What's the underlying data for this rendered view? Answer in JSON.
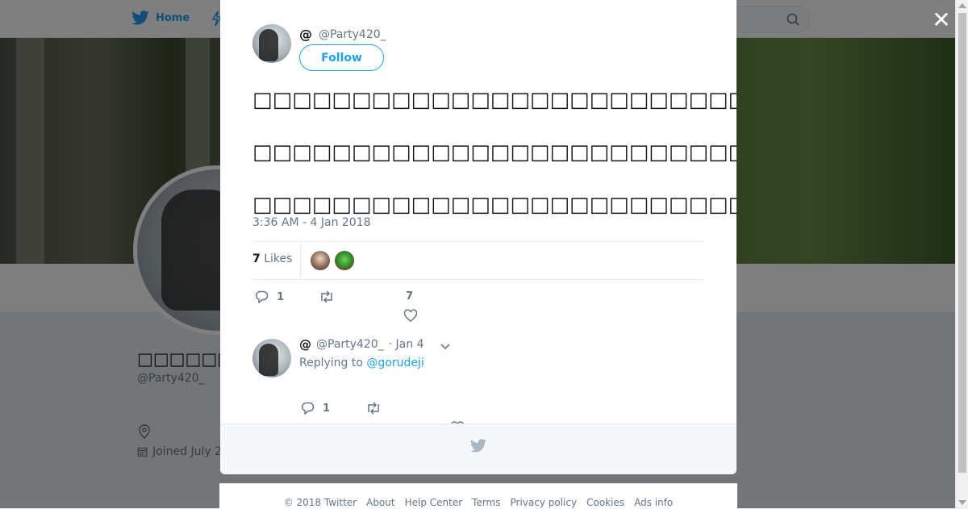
{
  "nav": {
    "home_label": "Home"
  },
  "profile": {
    "name": "□□□□□□□□",
    "handle": "@Party420_",
    "joined": "Joined July 2"
  },
  "tweet": {
    "author_at": "@",
    "author_handle": "@Party420_",
    "follow_label": "Follow",
    "lines": [
      "□□□□□□□□□□□□□□□□□□□□□□□□□□□□□□□□□□□□□□",
      "□□□□□□□□□□□□□□□□□□□□□□□□□□□□□□□□□□□□□□□□□□□😂",
      "□□□□□□□□□□□□□□□□□□□□□□□□□□"
    ],
    "timestamp": "3:36 AM - 4 Jan 2018",
    "likes_count": "7",
    "likes_label": "Likes",
    "reply_count": "1",
    "like_count": "7"
  },
  "reply": {
    "author_at": "@",
    "author_handle": "@Party420_",
    "date": "· Jan 4",
    "replying_prefix": "Replying to",
    "replying_to": "@gorudeji",
    "reply_count": "1"
  },
  "footer": {
    "links": [
      "© 2018 Twitter",
      "About",
      "Help Center",
      "Terms",
      "Privacy policy",
      "Cookies",
      "Ads info"
    ]
  },
  "colors": {
    "accent": "#1da1f2",
    "muted": "#657786",
    "text": "#14171a"
  }
}
